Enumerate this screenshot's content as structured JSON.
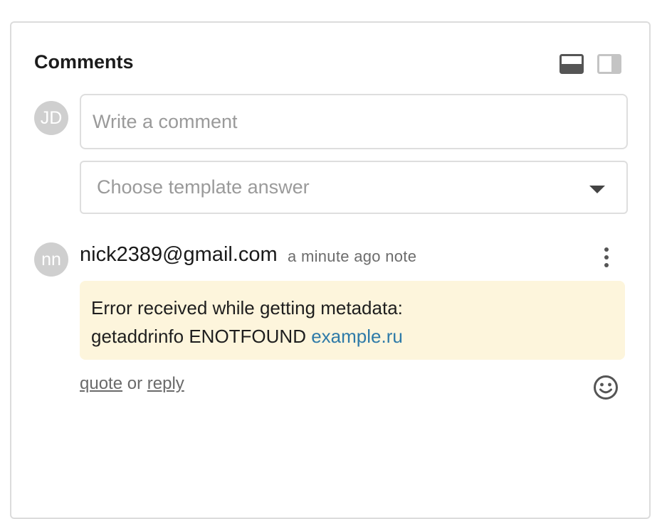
{
  "comments": {
    "title": "Comments",
    "layout_toggles": [
      {
        "icon": "layout-bottom-icon",
        "active": true
      },
      {
        "icon": "layout-side-icon",
        "active": false
      }
    ]
  },
  "new_comment": {
    "avatar_initials": "JD",
    "placeholder": "Write a comment",
    "template_select": {
      "placeholder": "Choose template answer"
    }
  },
  "comment": {
    "avatar_initials": "nn",
    "author": "nick2389@gmail.com",
    "time": "a minute ago",
    "type": "note",
    "body_line1": "Error received while getting metadata:",
    "body_line2_text": "getaddrinfo ENOTFOUND ",
    "body_link": "example.ru",
    "quote_label": "quote",
    "or_text": " or ",
    "reply_label": "reply",
    "body_bg_color": "#fdf5dc",
    "link_color": "#2e7aa8"
  }
}
